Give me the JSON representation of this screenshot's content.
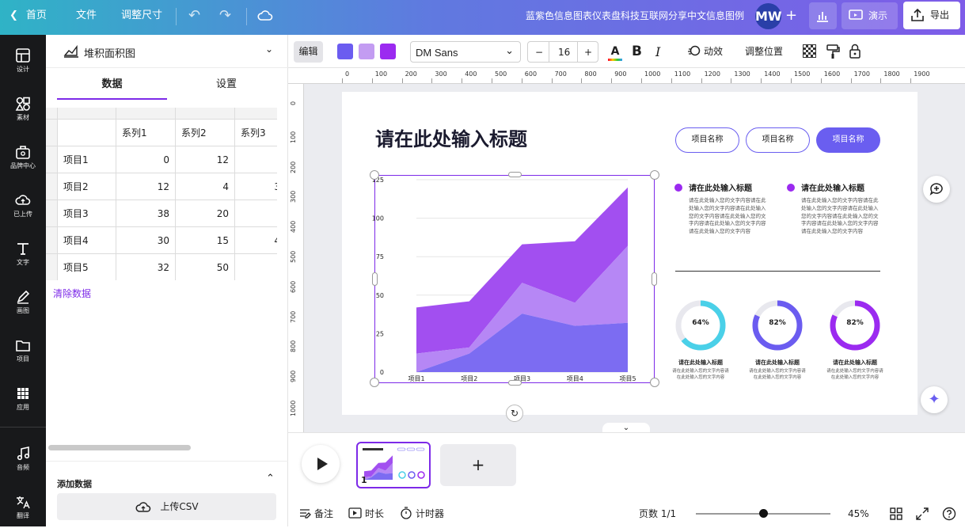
{
  "topbar": {
    "home": "首页",
    "file": "文件",
    "resize": "调整尺寸",
    "doc_title": "蓝紫色信息图表仪表盘科技互联网分享中文信息图例",
    "avatar": "MW",
    "plus": "+",
    "present": "演示",
    "export": "导出"
  },
  "rail": [
    {
      "label": "设计",
      "icon": "layout-icon"
    },
    {
      "label": "素材",
      "icon": "shapes-icon"
    },
    {
      "label": "品牌中心",
      "icon": "brand-icon"
    },
    {
      "label": "已上传",
      "icon": "cloud-upload-icon"
    },
    {
      "label": "文字",
      "icon": "text-icon"
    },
    {
      "label": "画图",
      "icon": "draw-icon"
    },
    {
      "label": "项目",
      "icon": "folder-icon"
    },
    {
      "label": "应用",
      "icon": "apps-icon"
    },
    {
      "label": "音频",
      "icon": "music-icon"
    },
    {
      "label": "翻译",
      "icon": "translate-icon"
    }
  ],
  "panel": {
    "chart_type": "堆积面积图",
    "tabs": [
      "数据",
      "设置"
    ],
    "table": {
      "headers": [
        "系列1",
        "系列2",
        "系列3"
      ],
      "rows": [
        {
          "label": "项目1",
          "values": [
            "0",
            "12",
            ""
          ]
        },
        {
          "label": "项目2",
          "values": [
            "12",
            "4",
            "3"
          ]
        },
        {
          "label": "项目3",
          "values": [
            "38",
            "20",
            ""
          ]
        },
        {
          "label": "项目4",
          "values": [
            "30",
            "15",
            "4"
          ]
        },
        {
          "label": "项目5",
          "values": [
            "32",
            "50",
            ""
          ]
        }
      ]
    },
    "clear_data": "清除数据",
    "add_data": "添加数据",
    "upload_csv": "上传CSV"
  },
  "toolbar": {
    "edit": "编辑",
    "colors": [
      "#6b5cf0",
      "#c39cf2",
      "#9b2af0"
    ],
    "font": "DM Sans",
    "font_size": "16",
    "minus": "−",
    "plus": "+",
    "animate": "动效",
    "position": "调整位置"
  },
  "rulers": {
    "h": [
      "0",
      "100",
      "200",
      "300",
      "400",
      "500",
      "600",
      "700",
      "800",
      "900",
      "1000",
      "1100",
      "1200",
      "1300",
      "1400",
      "1500",
      "1600",
      "1700",
      "1800",
      "1900"
    ],
    "v": [
      "0",
      "100",
      "200",
      "300",
      "400",
      "500",
      "600",
      "700",
      "800",
      "900",
      "1000"
    ]
  },
  "design": {
    "title": "请在此处输入标题",
    "pills": [
      "项目名称",
      "项目名称",
      "项目名称"
    ],
    "info": [
      {
        "heading": "请在此处输入标题",
        "body": "请在此处输入您的文字内容请在此处输入您的文字内容请在此处输入您的文字内容请在此处输入您的文字内容请在此处输入您的文字内容请在此处输入您的文字内容"
      },
      {
        "heading": "请在此处输入标题",
        "body": "请在此处输入您的文字内容请在此处输入您的文字内容请在此处输入您的文字内容请在此处输入您的文字内容请在此处输入您的文字内容请在此处输入您的文字内容"
      }
    ],
    "donuts": [
      {
        "percent": 64,
        "label": "64%",
        "heading": "请在此处输入标题",
        "body": "请在此处输入您的文字内容请在此处输入您的文字内容",
        "color": "#4ad0e8"
      },
      {
        "percent": 82,
        "label": "82%",
        "heading": "请在此处输入标题",
        "body": "请在此处输入您的文字内容请在此处输入您的文字内容",
        "color": "#6b5cf0"
      },
      {
        "percent": 82,
        "label": "82%",
        "heading": "请在此处输入标题",
        "body": "请在此处输入您的文字内容请在此处输入您的文字内容",
        "color": "#9b2af0"
      }
    ]
  },
  "chart_data": {
    "type": "area",
    "stacked": true,
    "categories": [
      "项目1",
      "项目2",
      "项目3",
      "项目4",
      "项目5"
    ],
    "series": [
      {
        "values": [
          0,
          12,
          38,
          30,
          32
        ],
        "color": "#7c6cf2"
      },
      {
        "values": [
          12,
          4,
          20,
          15,
          50
        ],
        "color": "#b687f5"
      },
      {
        "values": [
          30,
          30,
          25,
          40,
          38
        ],
        "color": "#a24ff0"
      }
    ],
    "ylim": [
      0,
      125
    ],
    "yticks": [
      "0",
      "25",
      "50",
      "75",
      "100",
      "125"
    ]
  },
  "bottom": {
    "notes": "备注",
    "duration": "时长",
    "timer": "计时器",
    "page_count": "页数 1/1",
    "zoom": "45%",
    "thumb_number": "1",
    "zoom_value": 0.5
  }
}
